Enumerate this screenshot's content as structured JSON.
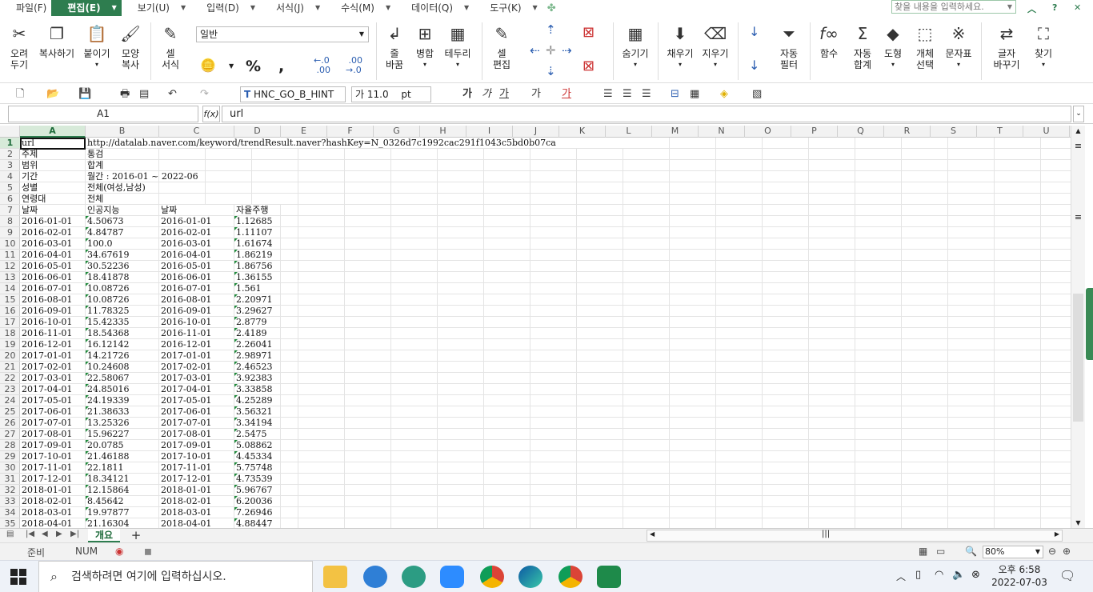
{
  "menu": {
    "items": [
      {
        "label": "파일(F)",
        "active": false
      },
      {
        "label": "편집(E)",
        "active": true
      },
      {
        "label": "보기(U)",
        "active": false
      },
      {
        "label": "입력(D)",
        "active": false
      },
      {
        "label": "서식(J)",
        "active": false
      },
      {
        "label": "수식(M)",
        "active": false
      },
      {
        "label": "데이터(Q)",
        "active": false
      },
      {
        "label": "도구(K)",
        "active": false
      }
    ],
    "search_placeholder": "찾을 내용을 입력하세요."
  },
  "ribbon": {
    "cut": "오려\n두기",
    "copy": "복사하기",
    "paste": "붙이기",
    "format_copy": "모양\n복사",
    "cell_format": "셀\n서식",
    "number_style": "일반",
    "wrap": "줄\n바꿈",
    "merge": "병합",
    "border": "테두리",
    "cell_edit": "셀\n편집",
    "hide": "숨기기",
    "fill": "채우기",
    "clear": "지우기",
    "autofilter": "자동\n필터",
    "function": "함수",
    "autosum": "자동\n합계",
    "shape": "도형",
    "object_select": "개체\n선택",
    "symbol": "문자표",
    "replace": "글자\n바꾸기",
    "find": "찾기"
  },
  "toolbar": {
    "font": "HNC_GO_B_HINT",
    "size": "11.0",
    "unit": "pt"
  },
  "formula": {
    "cell_ref": "A1",
    "fx": "f(x)",
    "content": "url"
  },
  "grid": {
    "columns": [
      "A",
      "B",
      "C",
      "D",
      "E",
      "F",
      "G",
      "H",
      "I",
      "J",
      "K",
      "L",
      "M",
      "N",
      "O",
      "P",
      "Q",
      "R",
      "S",
      "T",
      "U"
    ],
    "rows": [
      [
        "url",
        "http://datalab.naver.com/keyword/trendResult.naver?hashKey=N_0326d7c1992cac291f1043c5bd0b07ca",
        "",
        ""
      ],
      [
        "주제",
        "통검",
        "",
        ""
      ],
      [
        "범위",
        "합계",
        "",
        ""
      ],
      [
        "기간",
        "월간 : 2016-01 ~ 2022-06",
        "",
        ""
      ],
      [
        "성별",
        "전체(여성,남성)",
        "",
        ""
      ],
      [
        "연령대",
        "전체",
        "",
        ""
      ],
      [
        "날짜",
        "인공지능",
        "날짜",
        "자율주행"
      ],
      [
        "2016-01-01",
        "4.50673",
        "2016-01-01",
        "1.12685"
      ],
      [
        "2016-02-01",
        "4.84787",
        "2016-02-01",
        "1.11107"
      ],
      [
        "2016-03-01",
        "100.0",
        "2016-03-01",
        "1.61674"
      ],
      [
        "2016-04-01",
        "34.67619",
        "2016-04-01",
        "1.86219"
      ],
      [
        "2016-05-01",
        "30.52236",
        "2016-05-01",
        "1.86756"
      ],
      [
        "2016-06-01",
        "18.41878",
        "2016-06-01",
        "1.36155"
      ],
      [
        "2016-07-01",
        "10.08726",
        "2016-07-01",
        "1.561"
      ],
      [
        "2016-08-01",
        "10.08726",
        "2016-08-01",
        "2.20971"
      ],
      [
        "2016-09-01",
        "11.78325",
        "2016-09-01",
        "3.29627"
      ],
      [
        "2016-10-01",
        "15.42335",
        "2016-10-01",
        "2.8779"
      ],
      [
        "2016-11-01",
        "18.54368",
        "2016-11-01",
        "2.4189"
      ],
      [
        "2016-12-01",
        "16.12142",
        "2016-12-01",
        "2.26041"
      ],
      [
        "2017-01-01",
        "14.21726",
        "2017-01-01",
        "2.98971"
      ],
      [
        "2017-02-01",
        "10.24608",
        "2017-02-01",
        "2.46523"
      ],
      [
        "2017-03-01",
        "22.58067",
        "2017-03-01",
        "3.92383"
      ],
      [
        "2017-04-01",
        "24.85016",
        "2017-04-01",
        "3.33858"
      ],
      [
        "2017-05-01",
        "24.19339",
        "2017-05-01",
        "4.25289"
      ],
      [
        "2017-06-01",
        "21.38633",
        "2017-06-01",
        "3.56321"
      ],
      [
        "2017-07-01",
        "13.25326",
        "2017-07-01",
        "3.34194"
      ],
      [
        "2017-08-01",
        "15.96227",
        "2017-08-01",
        "2.5475"
      ],
      [
        "2017-09-01",
        "20.0785",
        "2017-09-01",
        "5.08862"
      ],
      [
        "2017-10-01",
        "21.46188",
        "2017-10-01",
        "4.45334"
      ],
      [
        "2017-11-01",
        "22.1811",
        "2017-11-01",
        "5.75748"
      ],
      [
        "2017-12-01",
        "18.34121",
        "2017-12-01",
        "4.73539"
      ],
      [
        "2018-01-01",
        "12.15864",
        "2018-01-01",
        "5.96767"
      ],
      [
        "2018-02-01",
        "8.45642",
        "2018-02-01",
        "6.20036"
      ],
      [
        "2018-03-01",
        "19.97877",
        "2018-03-01",
        "7.26946"
      ],
      [
        "2018-04-01",
        "21.16304",
        "2018-04-01",
        "4.88447"
      ]
    ]
  },
  "sheet": {
    "tab": "개요",
    "add": "+"
  },
  "status": {
    "mode": "준비",
    "num": "NUM",
    "zoom": "80%"
  },
  "taskbar": {
    "search": "검색하려면 여기에 입력하십시오.",
    "time": "오후 6:58",
    "date": "2022-07-03"
  },
  "colors": {
    "accent": "#2e7d4f",
    "selection": "#d7ead9"
  }
}
